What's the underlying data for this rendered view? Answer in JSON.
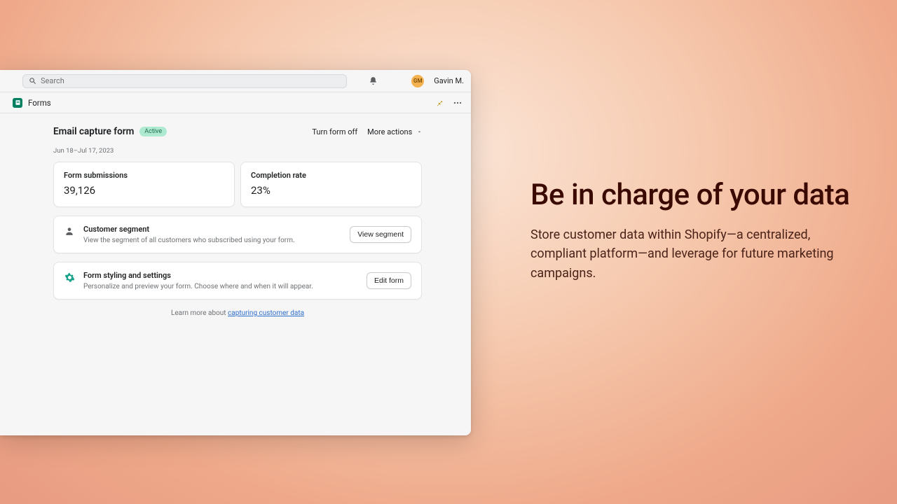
{
  "topbar": {
    "search_placeholder": "Search",
    "avatar_initials": "GM",
    "username": "Gavin M."
  },
  "subbar": {
    "app_name": "Forms"
  },
  "page": {
    "title": "Email capture form",
    "status_badge": "Active",
    "turn_off_label": "Turn form off",
    "more_actions_label": "More actions",
    "date_range": "Jun 18–Jul 17, 2023"
  },
  "metrics": [
    {
      "label": "Form submissions",
      "value": "39,126"
    },
    {
      "label": "Completion rate",
      "value": "23%"
    }
  ],
  "sections": {
    "segment": {
      "title": "Customer segment",
      "subtitle": "View the segment of all customers who subscribed using your form.",
      "button": "View segment"
    },
    "styling": {
      "title": "Form styling and settings",
      "subtitle": "Personalize and preview your form. Choose where and when it will appear.",
      "button": "Edit form"
    }
  },
  "footer": {
    "prefix": "Learn more about ",
    "link": "capturing customer data"
  },
  "promo": {
    "heading": "Be in charge of your data",
    "body": "Store customer data within Shopify—a centralized, compliant platform—and leverage for future marketing campaigns."
  }
}
